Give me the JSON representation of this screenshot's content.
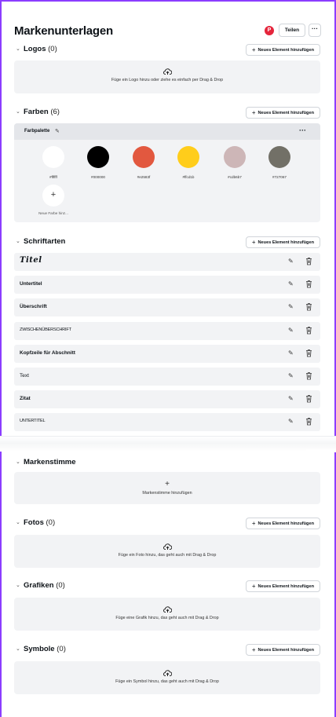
{
  "header": {
    "title": "Markenunterlagen",
    "avatar_letter": "P",
    "share_label": "Teilen",
    "more_label": "···"
  },
  "add_button_label": "Neues Element hinzufügen",
  "sections": {
    "logos": {
      "title": "Logos",
      "count": "(0)",
      "hint": "Füge ein Logo hinzu oder ziehe es einfach per Drag & Drop"
    },
    "colors": {
      "title": "Farben",
      "count": "(6)",
      "palette_label": "Farbpalette",
      "swatches": [
        {
          "hex": "#ffffff",
          "label": "#ffffff"
        },
        {
          "hex": "#000000",
          "label": "#000000"
        },
        {
          "hex": "#e2583f",
          "label": "#e2583f"
        },
        {
          "hex": "#ffcd1b",
          "label": "#ffcd1b"
        },
        {
          "hex": "#cdb6b7",
          "label": "#cdb6b7"
        },
        {
          "hex": "#727067",
          "label": "#727067"
        }
      ],
      "add_color_label": "Neue Farbe hinz..."
    },
    "fonts": {
      "title": "Schriftarten",
      "rows": [
        "Titel",
        "Untertitel",
        "Überschrift",
        "ZWISCHENÜBERSCHRIFT",
        "Kopfzeile für Abschnitt",
        "Text",
        "Zitat",
        "UNTERTITEL"
      ]
    },
    "voice": {
      "title": "Markenstimme",
      "hint": "Markenstimme hinzufügen"
    },
    "photos": {
      "title": "Fotos",
      "count": "(0)",
      "hint": "Füge ein Foto hinzu, das geht auch mit Drag & Drop"
    },
    "graphics": {
      "title": "Grafiken",
      "count": "(0)",
      "hint": "Füge eine Grafik hinzu, das geht auch mit Drag & Drop"
    },
    "symbols": {
      "title": "Symbole",
      "count": "(0)",
      "hint": "Füge ein Symbol hinzu, das geht auch mit Drag & Drop"
    }
  },
  "icons": {
    "collapse": "chevron-down-icon",
    "upload": "cloud-upload-icon",
    "edit": "pencil-icon",
    "delete": "trash-icon",
    "add": "plus-icon"
  }
}
